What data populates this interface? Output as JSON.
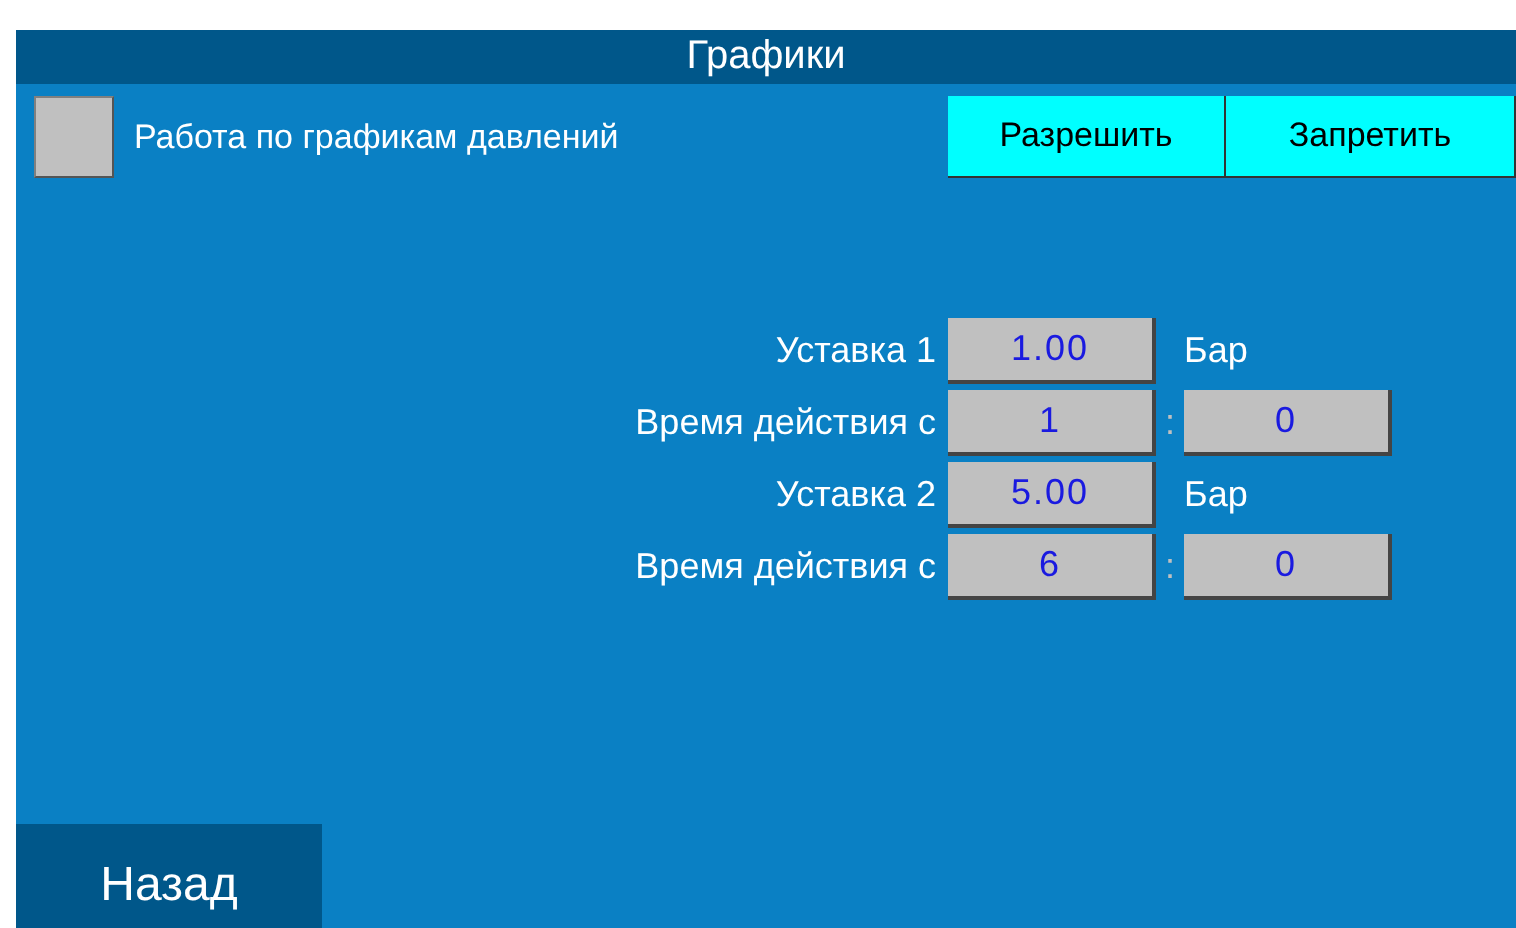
{
  "window": {
    "title": "Графики"
  },
  "mode": {
    "label": "Работа по графикам давлений",
    "checked": false
  },
  "buttons": [
    "Разрешить",
    "Запретить"
  ],
  "settings": [
    {
      "kind": "setpoint",
      "label": "Уставка 1",
      "value": "1.00",
      "unit": "Бар"
    },
    {
      "kind": "time",
      "label": "Время действия с",
      "hours": "1",
      "separator": ":",
      "minutes": "0"
    },
    {
      "kind": "setpoint",
      "label": "Уставка 2",
      "value": "5.00",
      "unit": "Бар"
    },
    {
      "kind": "time",
      "label": "Время действия с",
      "hours": "6",
      "separator": ":",
      "minutes": "0"
    }
  ],
  "back_button": "Назад"
}
